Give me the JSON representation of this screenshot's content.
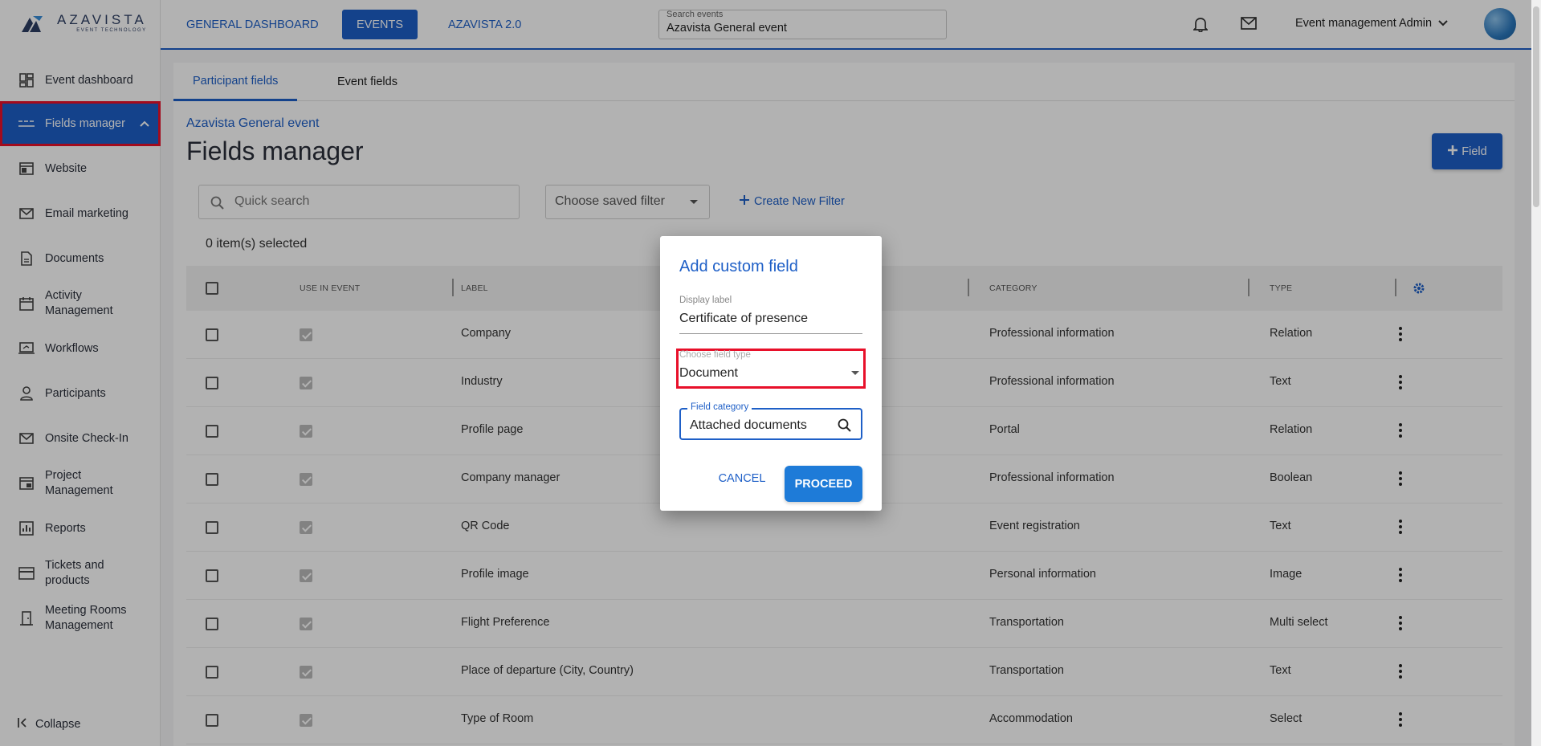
{
  "app": {
    "logo_name": "AZAVISTA",
    "logo_sub": "EVENT TECHNOLOGY"
  },
  "sidebar": {
    "items": [
      {
        "label": "Event dashboard",
        "icon": "dashboard-icon"
      },
      {
        "label": "Fields manager",
        "icon": "fields-icon",
        "active": true
      },
      {
        "label": "Website",
        "icon": "website-icon"
      },
      {
        "label": "Email marketing",
        "icon": "mail-icon"
      },
      {
        "label": "Documents",
        "icon": "document-icon"
      },
      {
        "label": "Activity Management",
        "icon": "calendar-icon"
      },
      {
        "label": "Workflows",
        "icon": "workflow-icon"
      },
      {
        "label": "Participants",
        "icon": "person-icon"
      },
      {
        "label": "Onsite Check-In",
        "icon": "mail-icon"
      },
      {
        "label": "Project Management",
        "icon": "project-icon"
      },
      {
        "label": "Reports",
        "icon": "reports-icon"
      },
      {
        "label": "Tickets and products",
        "icon": "ticket-icon"
      },
      {
        "label": "Meeting Rooms Management",
        "icon": "door-icon"
      }
    ],
    "collapse_label": "Collapse"
  },
  "header": {
    "tabs": [
      {
        "label": "GENERAL DASHBOARD",
        "active": false
      },
      {
        "label": "EVENTS",
        "active": true
      },
      {
        "label": "AZAVISTA 2.0",
        "active": false
      }
    ],
    "search": {
      "label": "Search events",
      "value": "Azavista General event"
    },
    "user_name": "Event management Admin"
  },
  "content": {
    "tabs": [
      {
        "label": "Participant fields",
        "active": true
      },
      {
        "label": "Event fields",
        "active": false
      }
    ],
    "event_name": "Azavista General event",
    "title": "Fields manager",
    "add_field_label": "Field",
    "quick_search_placeholder": "Quick search",
    "saved_filter_placeholder": "Choose saved filter",
    "create_filter_label": "Create New Filter",
    "selected_count": "0 item(s) selected"
  },
  "table": {
    "headers": {
      "use_in_event": "USE IN EVENT",
      "label": "LABEL",
      "category": "CATEGORY",
      "type": "TYPE"
    },
    "rows": [
      {
        "label": "Company",
        "category": "Professional information",
        "type": "Relation"
      },
      {
        "label": "Industry",
        "category": "Professional information",
        "type": "Text"
      },
      {
        "label": "Profile page",
        "category": "Portal",
        "type": "Relation"
      },
      {
        "label": "Company manager",
        "category": "Professional information",
        "type": "Boolean"
      },
      {
        "label": "QR Code",
        "category": "Event registration",
        "type": "Text"
      },
      {
        "label": "Profile image",
        "category": "Personal information",
        "type": "Image"
      },
      {
        "label": "Flight Preference",
        "category": "Transportation",
        "type": "Multi select"
      },
      {
        "label": "Place of departure (City, Country)",
        "category": "Transportation",
        "type": "Text"
      },
      {
        "label": "Type of Room",
        "category": "Accommodation",
        "type": "Select"
      }
    ]
  },
  "dialog": {
    "title": "Add custom field",
    "display_label_label": "Display label",
    "display_label_value": "Certificate of presence",
    "field_type_label": "Choose field type",
    "field_type_value": "Document",
    "field_category_label": "Field category",
    "field_category_value": "Attached documents",
    "cancel_label": "CANCEL",
    "proceed_label": "PROCEED"
  },
  "colors": {
    "primary": "#1e5fc7",
    "highlight": "#e8102a"
  }
}
